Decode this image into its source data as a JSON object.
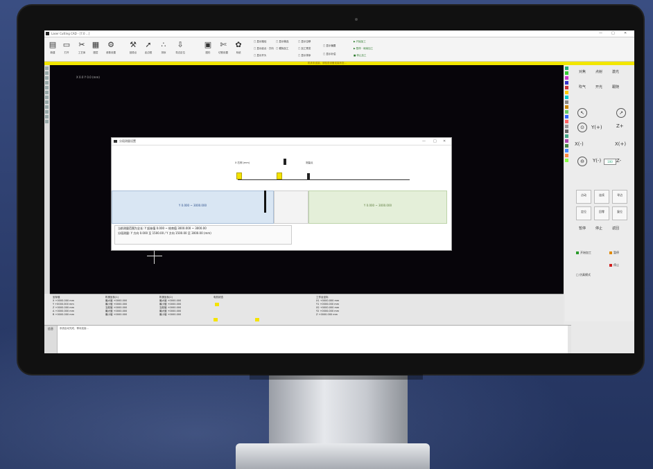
{
  "app": {
    "title": "Laser Cutting CAD - [7.0 ...]",
    "window_buttons": [
      "—",
      "□",
      "✕"
    ]
  },
  "ribbon": {
    "buttons": [
      {
        "icon": "file-icon",
        "glyph": "▤",
        "label": "新建"
      },
      {
        "icon": "folder-icon",
        "glyph": "▭",
        "label": "打开"
      },
      {
        "icon": "cut-icon",
        "glyph": "✂",
        "label": "工艺库"
      },
      {
        "icon": "layer-icon",
        "glyph": "▦",
        "label": "图层"
      },
      {
        "icon": "gear-icon",
        "glyph": "⚙",
        "label": "参数设置"
      },
      {
        "icon": "tool-icon",
        "glyph": "⚒",
        "label": "回原点"
      },
      {
        "icon": "arrow-icon",
        "glyph": "➚",
        "label": "走边框"
      },
      {
        "icon": "scatter-icon",
        "glyph": "∴",
        "label": "排序"
      },
      {
        "icon": "download-icon",
        "glyph": "⇩",
        "label": "寻边定位"
      },
      {
        "icon": "image-icon",
        "glyph": "▣",
        "label": "图形"
      },
      {
        "icon": "scissors-icon",
        "glyph": "✄",
        "label": "切割设置"
      },
      {
        "icon": "settings-icon",
        "glyph": "✿",
        "label": "系统"
      }
    ],
    "options": [
      "□ 显示路径",
      "□ 显示起点 · 方向",
      "□ 显示开头",
      "□ 显示微连",
      "□ 模拟加工",
      "□ 显示空移",
      "□ 加工预览",
      "□ 显示排序",
      "□ 显示偏置",
      "□ 显示补偿"
    ],
    "green_options": [
      "▶ 开始加工",
      "▶ 暂停 · 继续加工",
      "■ 停止加工"
    ]
  },
  "alert_text": "机床未连接，请检查设备连接状态...",
  "canvas": {
    "coord_text": "X 0.0 Y 0.0 (mm)"
  },
  "dialog": {
    "title": "分段测量设置",
    "labels": {
      "left": "X 右侧 (mm)",
      "right": "测量点"
    },
    "left_seg": "Y 0.000 ~ 3000.000",
    "right_seg": "Y 0.000 ~ 3000.000",
    "note_line1": "当前测量范围为全长: Y 起始值 0.000 ~ 结束值 3000.000 ~ 3000.00",
    "note_line2": "分段测量: Y 方向 0.000 至 1500.00 / Y 方向 1500.00 至 3000.00 (mm)"
  },
  "right_panel": {
    "top_buttons": [
      "对焦",
      "点射",
      "激光",
      "吹气",
      "开光",
      "跟随"
    ],
    "jog": {
      "y_plus": "Y(+)",
      "x_minus": "X(-)",
      "x_plus": "X(+)",
      "y_minus": "Y(-)",
      "z_plus": "Z+",
      "z_minus": "Z-"
    },
    "speed_value": "100",
    "mode_buttons": [
      "点动",
      "连续",
      "寻边",
      "定位",
      "回零",
      "复位"
    ],
    "bottom_buttons": [
      "暂停",
      "停止",
      "返回"
    ],
    "actions": [
      {
        "label": "开始加工",
        "color": "#2a9a2a"
      },
      {
        "label": "暂停",
        "color": "#e08a00"
      },
      {
        "label": "停止",
        "color": "#d02020"
      }
    ],
    "checkbox": "□ 仿真模式",
    "swatches": [
      "#2a7",
      "#3c3",
      "#c3c",
      "#33c",
      "#c33",
      "#fc0",
      "#0cc",
      "#888",
      "#c80",
      "#6c6",
      "#36f",
      "#f66",
      "#999",
      "#666",
      "#4a8",
      "#a4a",
      "#484",
      "#48f",
      "#f84",
      "#8f4"
    ]
  },
  "bottom_panel": {
    "col1": {
      "title": "坐标值",
      "rows": [
        "X +0000.000 mm",
        "Y +0000.000 mm",
        "Z +0000.000 mm",
        "A +0000.000 mm",
        "B +0000.000 mm"
      ]
    },
    "col2": {
      "title": "机械坐标(1)",
      "rows": [
        "最大值 +0000.000",
        "最小值 +0000.000",
        "当前值 +0000.000",
        "最大值 +0000.000",
        "最小值 +0000.000"
      ]
    },
    "col3": {
      "title": "机械坐标(2)",
      "rows": [
        "最大值 +0000.000",
        "最小值 +0000.000",
        "当前值 +0000.000",
        "最大值 +0000.000",
        "最小值 +0000.000"
      ]
    },
    "col4": {
      "title": "电机状态"
    },
    "col5": {
      "title": "工作台坐标",
      "rows": [
        "X1 +0000.000 mm",
        "Y1 +0000.000 mm",
        "X2 +0000.000 mm",
        "Y2 +0000.000 mm",
        "Z  +0000.000 mm"
      ]
    }
  },
  "log": {
    "tab": "信息",
    "message": "系统启动完成，等待连接..."
  }
}
